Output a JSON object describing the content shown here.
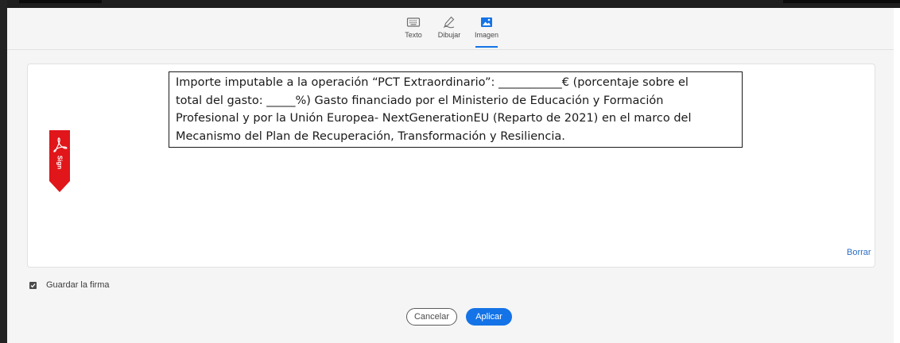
{
  "tabs": [
    {
      "label": "Texto",
      "icon": "keyboard-icon",
      "active": false
    },
    {
      "label": "Dibujar",
      "icon": "pen-draw-icon",
      "active": false
    },
    {
      "label": "Imagen",
      "icon": "image-icon",
      "active": true
    }
  ],
  "signature_text": {
    "lines": [
      "Importe imputable a la operación “PCT Extraordinario”: ___________€ (porcentaje sobre el",
      "total del gasto: _____%) Gasto financiado por el Ministerio de Educación y Formación",
      "Profesional y por la Unión Europea- NextGenerationEU (Reparto de 2021) en el marco del",
      "Mecanismo del Plan de Recuperación, Transformación y Resiliencia."
    ]
  },
  "sign_flag": {
    "label": "Sign",
    "icon": "acrobat-icon"
  },
  "clear_link": "Borrar",
  "save_signature": {
    "label": "Guardar la firma",
    "checked": true
  },
  "buttons": {
    "cancel": "Cancelar",
    "apply": "Aplicar"
  },
  "colors": {
    "accent": "#1473e6",
    "flag": "#e0161b",
    "link": "#2d6fc4"
  }
}
